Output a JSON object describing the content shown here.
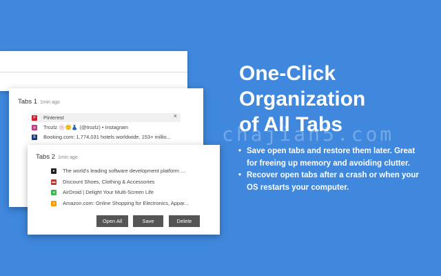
{
  "card1": {
    "title": "Tabs 1",
    "time": "1min ago",
    "close_symbol": "×",
    "tabs": [
      {
        "title": "Pinterest",
        "icon": "pinterest-icon",
        "color": "#cf1f2e",
        "glyph": "P"
      },
      {
        "title": "Trozlz 🍥🙂👗 (@trozlz) • Instagram",
        "icon": "instagram-icon",
        "color": "#c13584",
        "glyph": "◎"
      },
      {
        "title": "Booking.com: 1,774,031 hotels worldwide. 153+ millio...",
        "icon": "booking-icon",
        "color": "#1a3a7a",
        "glyph": "B"
      }
    ]
  },
  "card2": {
    "title": "Tabs 2",
    "time": "1min ago",
    "tabs": [
      {
        "title": "The world's leading software development platform ...",
        "icon": "github-icon",
        "color": "#222222",
        "glyph": "●"
      },
      {
        "title": "Discount Shoes, Clothing & Accessories",
        "icon": "store-icon",
        "color": "#c0392b",
        "glyph": "▬"
      },
      {
        "title": "AirDroid | Delight Your Multi-Screen Life",
        "icon": "airdroid-icon",
        "color": "#3cba54",
        "glyph": "◂"
      },
      {
        "title": "Amazon.com: Online Shopping for Electronics, Appar...",
        "icon": "amazon-icon",
        "color": "#ff9900",
        "glyph": "a"
      }
    ],
    "buttons": {
      "open_all": "Open All",
      "save": "Save",
      "delete": "Delete"
    }
  },
  "promo": {
    "headline": [
      "One-Click",
      "Organization",
      "of All Tabs"
    ],
    "bullets": [
      "Save open tabs and restore them later. Great for freeing up memory and avoiding clutter.",
      "Recover open tabs after a crash or when your OS restarts your computer."
    ]
  },
  "watermark": "chajian5.com"
}
